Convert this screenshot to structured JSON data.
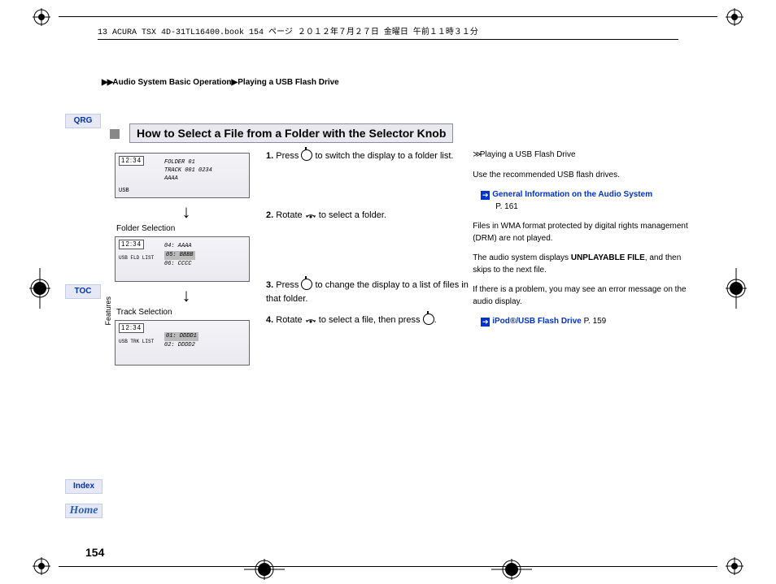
{
  "header_path": "13 ACURA TSX 4D-31TL16400.book  154 ページ  ２０１２年７月２７日  金曜日  午前１１時３１分",
  "breadcrumb": {
    "arrows": "▶▶",
    "a": "Audio System Basic Operation",
    "sep": "▶",
    "b": "Playing a USB Flash Drive"
  },
  "nav": {
    "qrg": "QRG",
    "toc": "TOC",
    "index": "Index",
    "home": "Home",
    "features": "Features"
  },
  "title": "How to Select a File from a Folder with the Selector Knob",
  "displays": {
    "d1": {
      "clock": "12:34",
      "l1": "FOLDER 01",
      "l2": "TRACK 001   0234",
      "l3": "AAAA",
      "mode": "USB"
    },
    "caption1": "Folder Selection",
    "d2": {
      "clock": "12:34",
      "l1": "04: AAAA",
      "l2": "05: BBBB",
      "l3": "06: CCCC",
      "mode": "USB  FLD LIST"
    },
    "caption2": "Track Selection",
    "d3": {
      "clock": "12:34",
      "l1": "",
      "l2": "01: DDDD1",
      "l3": "02: DDDD2",
      "mode": "USB  TRK LIST"
    }
  },
  "steps": {
    "s1a": "1.",
    "s1b": "Press ",
    "s1c": " to switch the display to a folder list.",
    "s2a": "2.",
    "s2b": "Rotate ",
    "s2c": " to select a folder.",
    "s3a": "3.",
    "s3b": "Press ",
    "s3c": " to change the display to a list of files in that folder.",
    "s4a": "4.",
    "s4b": "Rotate ",
    "s4c": " to select a file, then press ",
    "s4d": "."
  },
  "side": {
    "head": "Playing a USB Flash Drive",
    "p1": "Use the recommended USB flash drives.",
    "link1": "General Information on the Audio System",
    "link1p": "P. 161",
    "p2": "Files in WMA format protected by digital rights management (DRM) are not played.",
    "p3a": "The audio system displays ",
    "p3b": "UNPLAYABLE FILE",
    "p3c": ", and then skips to the next file.",
    "p4": "If there is a problem, you may see an error message on the audio display.",
    "link2": "iPod®/USB Flash Drive ",
    "link2p": "P. 159"
  },
  "page_no": "154"
}
